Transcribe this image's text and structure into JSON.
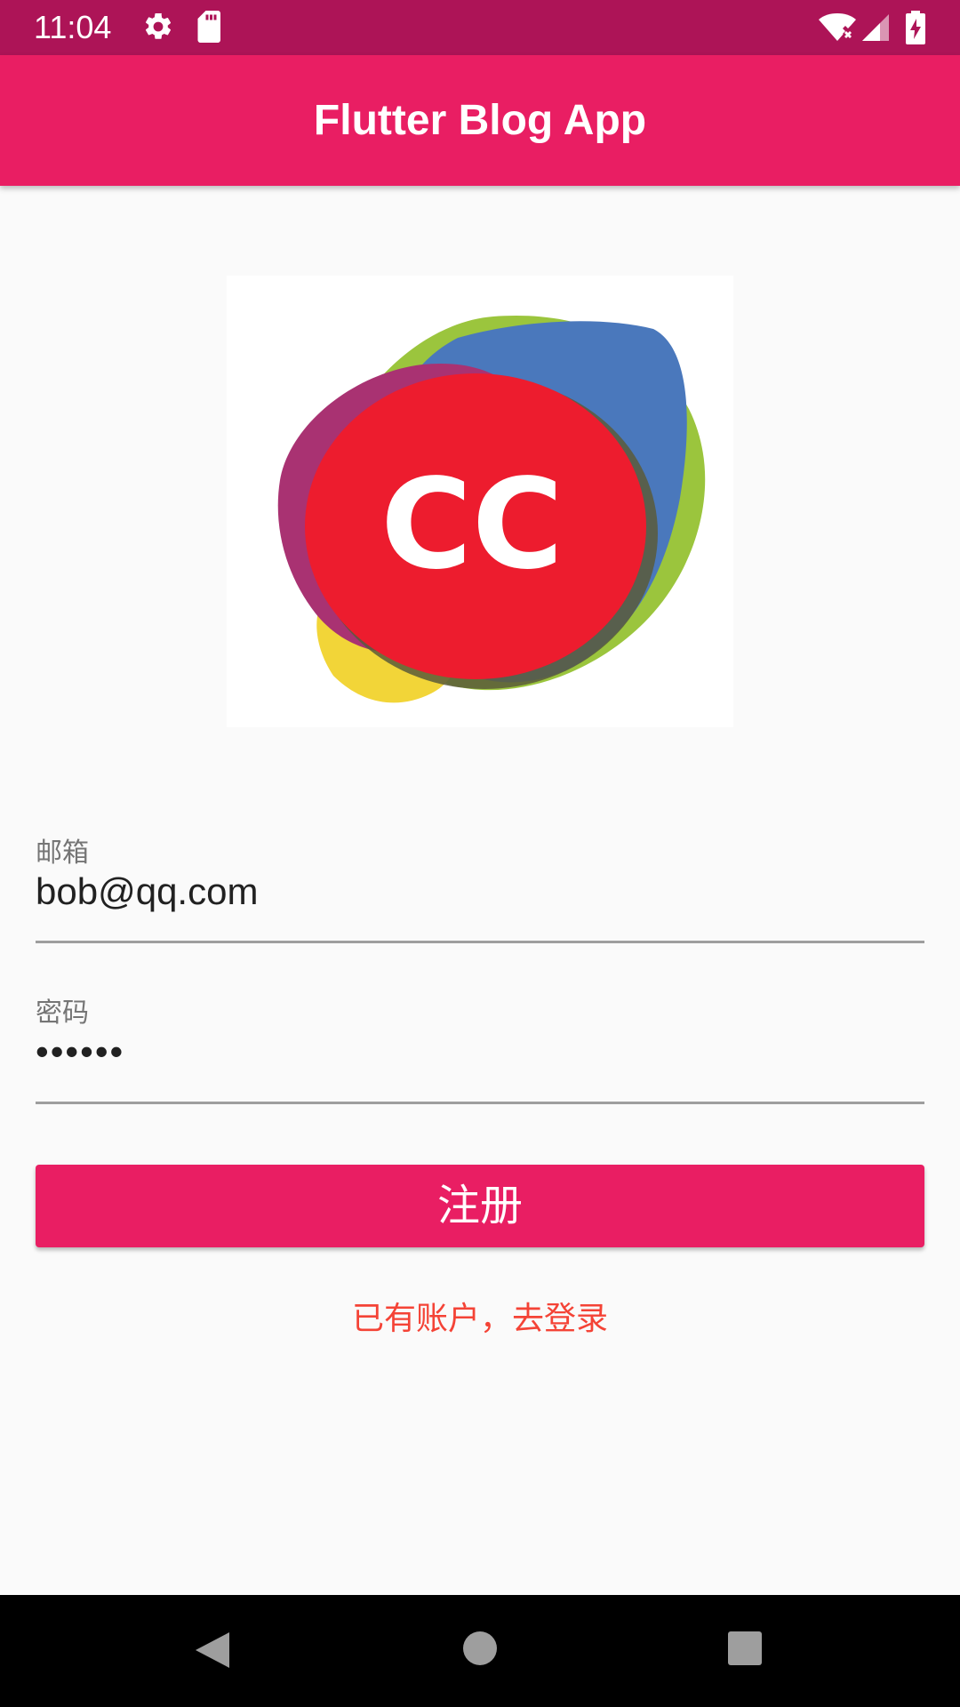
{
  "status_bar": {
    "time": "11:04",
    "icons": [
      "gear-icon",
      "sd-card-icon",
      "wifi-off-icon",
      "signal-icon",
      "battery-charging-icon"
    ],
    "color": "#ad1457"
  },
  "app_bar": {
    "title": "Flutter Blog App",
    "color": "#e91e63"
  },
  "logo": {
    "text": "CC",
    "colors": [
      "#9bc53d",
      "#4a78bc",
      "#a93272",
      "#ed1c2e",
      "#f2d538"
    ]
  },
  "form": {
    "email": {
      "label": "邮箱",
      "value": "bob@qq.com"
    },
    "password": {
      "label": "密码",
      "value": "••••••"
    },
    "register_label": "注册",
    "login_link": "已有账户，去登录",
    "accent_color": "#e91e63",
    "link_color": "#f44336"
  },
  "nav_bar": {
    "icons": [
      "back-icon",
      "home-icon",
      "recents-icon"
    ]
  }
}
